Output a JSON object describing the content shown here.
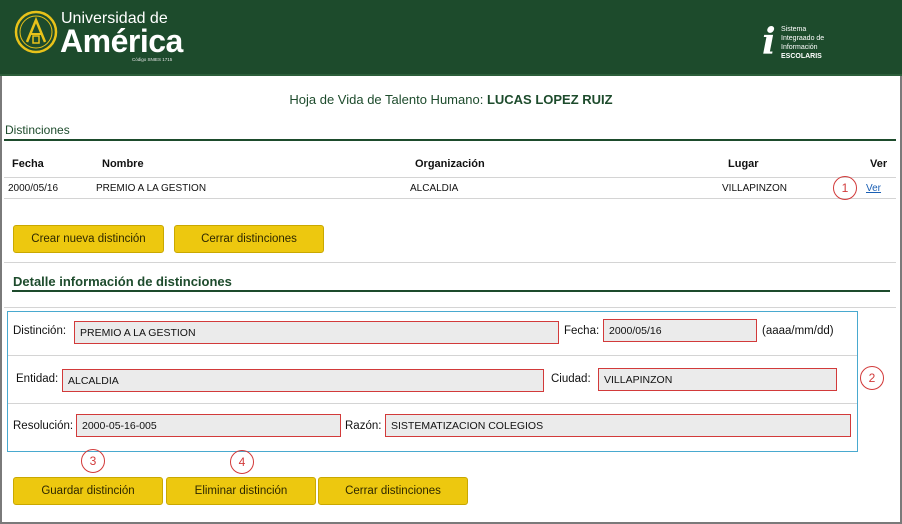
{
  "header": {
    "university_line1": "Universidad de",
    "university_line2": "América",
    "university_code": "Código SNIES 1715",
    "system_line1": "Sistema",
    "system_line2": "Integraado de",
    "system_line3": "Información",
    "system_line4": "ESCOLARIS",
    "brand_color": "#1d4b2c"
  },
  "page": {
    "title_prefix": "Hoja de Vida de Talento Humano:",
    "person_name": "LUCAS LOPEZ RUIZ",
    "section_title": "Distinciones"
  },
  "table": {
    "headers": [
      "Fecha",
      "Nombre",
      "Organización",
      "Lugar",
      "Ver"
    ],
    "rows": [
      {
        "fecha": "2000/05/16",
        "nombre": "PREMIO A LA GESTION",
        "organizacion": "ALCALDIA",
        "lugar": "VILLAPINZON",
        "ver": "Ver"
      }
    ]
  },
  "buttons": {
    "create": "Crear nueva distinción",
    "close_top": "Cerrar distinciones",
    "save": "Guardar distinción",
    "delete": "Eliminar distinción",
    "close_bottom": "Cerrar distinciones",
    "button_color": "#edc80f"
  },
  "detail": {
    "title": "Detalle información de distinciones",
    "distincion_label": "Distinción:",
    "distincion_value": "PREMIO A LA GESTION",
    "fecha_label": "Fecha:",
    "fecha_value": "2000/05/16",
    "fecha_hint": "(aaaa/mm/dd)",
    "entidad_label": "Entidad:",
    "entidad_value": "ALCALDIA",
    "ciudad_label": "Ciudad:",
    "ciudad_value": "VILLAPINZON",
    "resolucion_label": "Resolución:",
    "resolucion_value": "2000-05-16-005",
    "razon_label": "Razón:",
    "razon_value": "SISTEMATIZACION COLEGIOS"
  },
  "annotations": [
    "1",
    "2",
    "3",
    "4"
  ]
}
